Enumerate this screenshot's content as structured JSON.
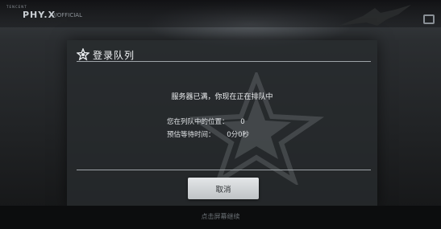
{
  "game": {
    "logo_small": "TENCENT",
    "logo_main": "PHY.X",
    "logo_sub": "//OFFICIAL"
  },
  "dialog": {
    "title": "登录队列",
    "header_icon": "winged-star-icon",
    "message": "服务器已满，你现在正在排队中",
    "position_label": "您在列队中的位置：",
    "position_value": "0",
    "wait_label": "预估等待时间：",
    "wait_value": "0分0秒",
    "cancel_label": "取消"
  },
  "footer": {
    "hint": "点击屏幕继续"
  },
  "colors": {
    "panel": "#2a2d30",
    "text": "#eef0f2",
    "button": "#d6d9db",
    "divider": "#9ea4a9"
  }
}
